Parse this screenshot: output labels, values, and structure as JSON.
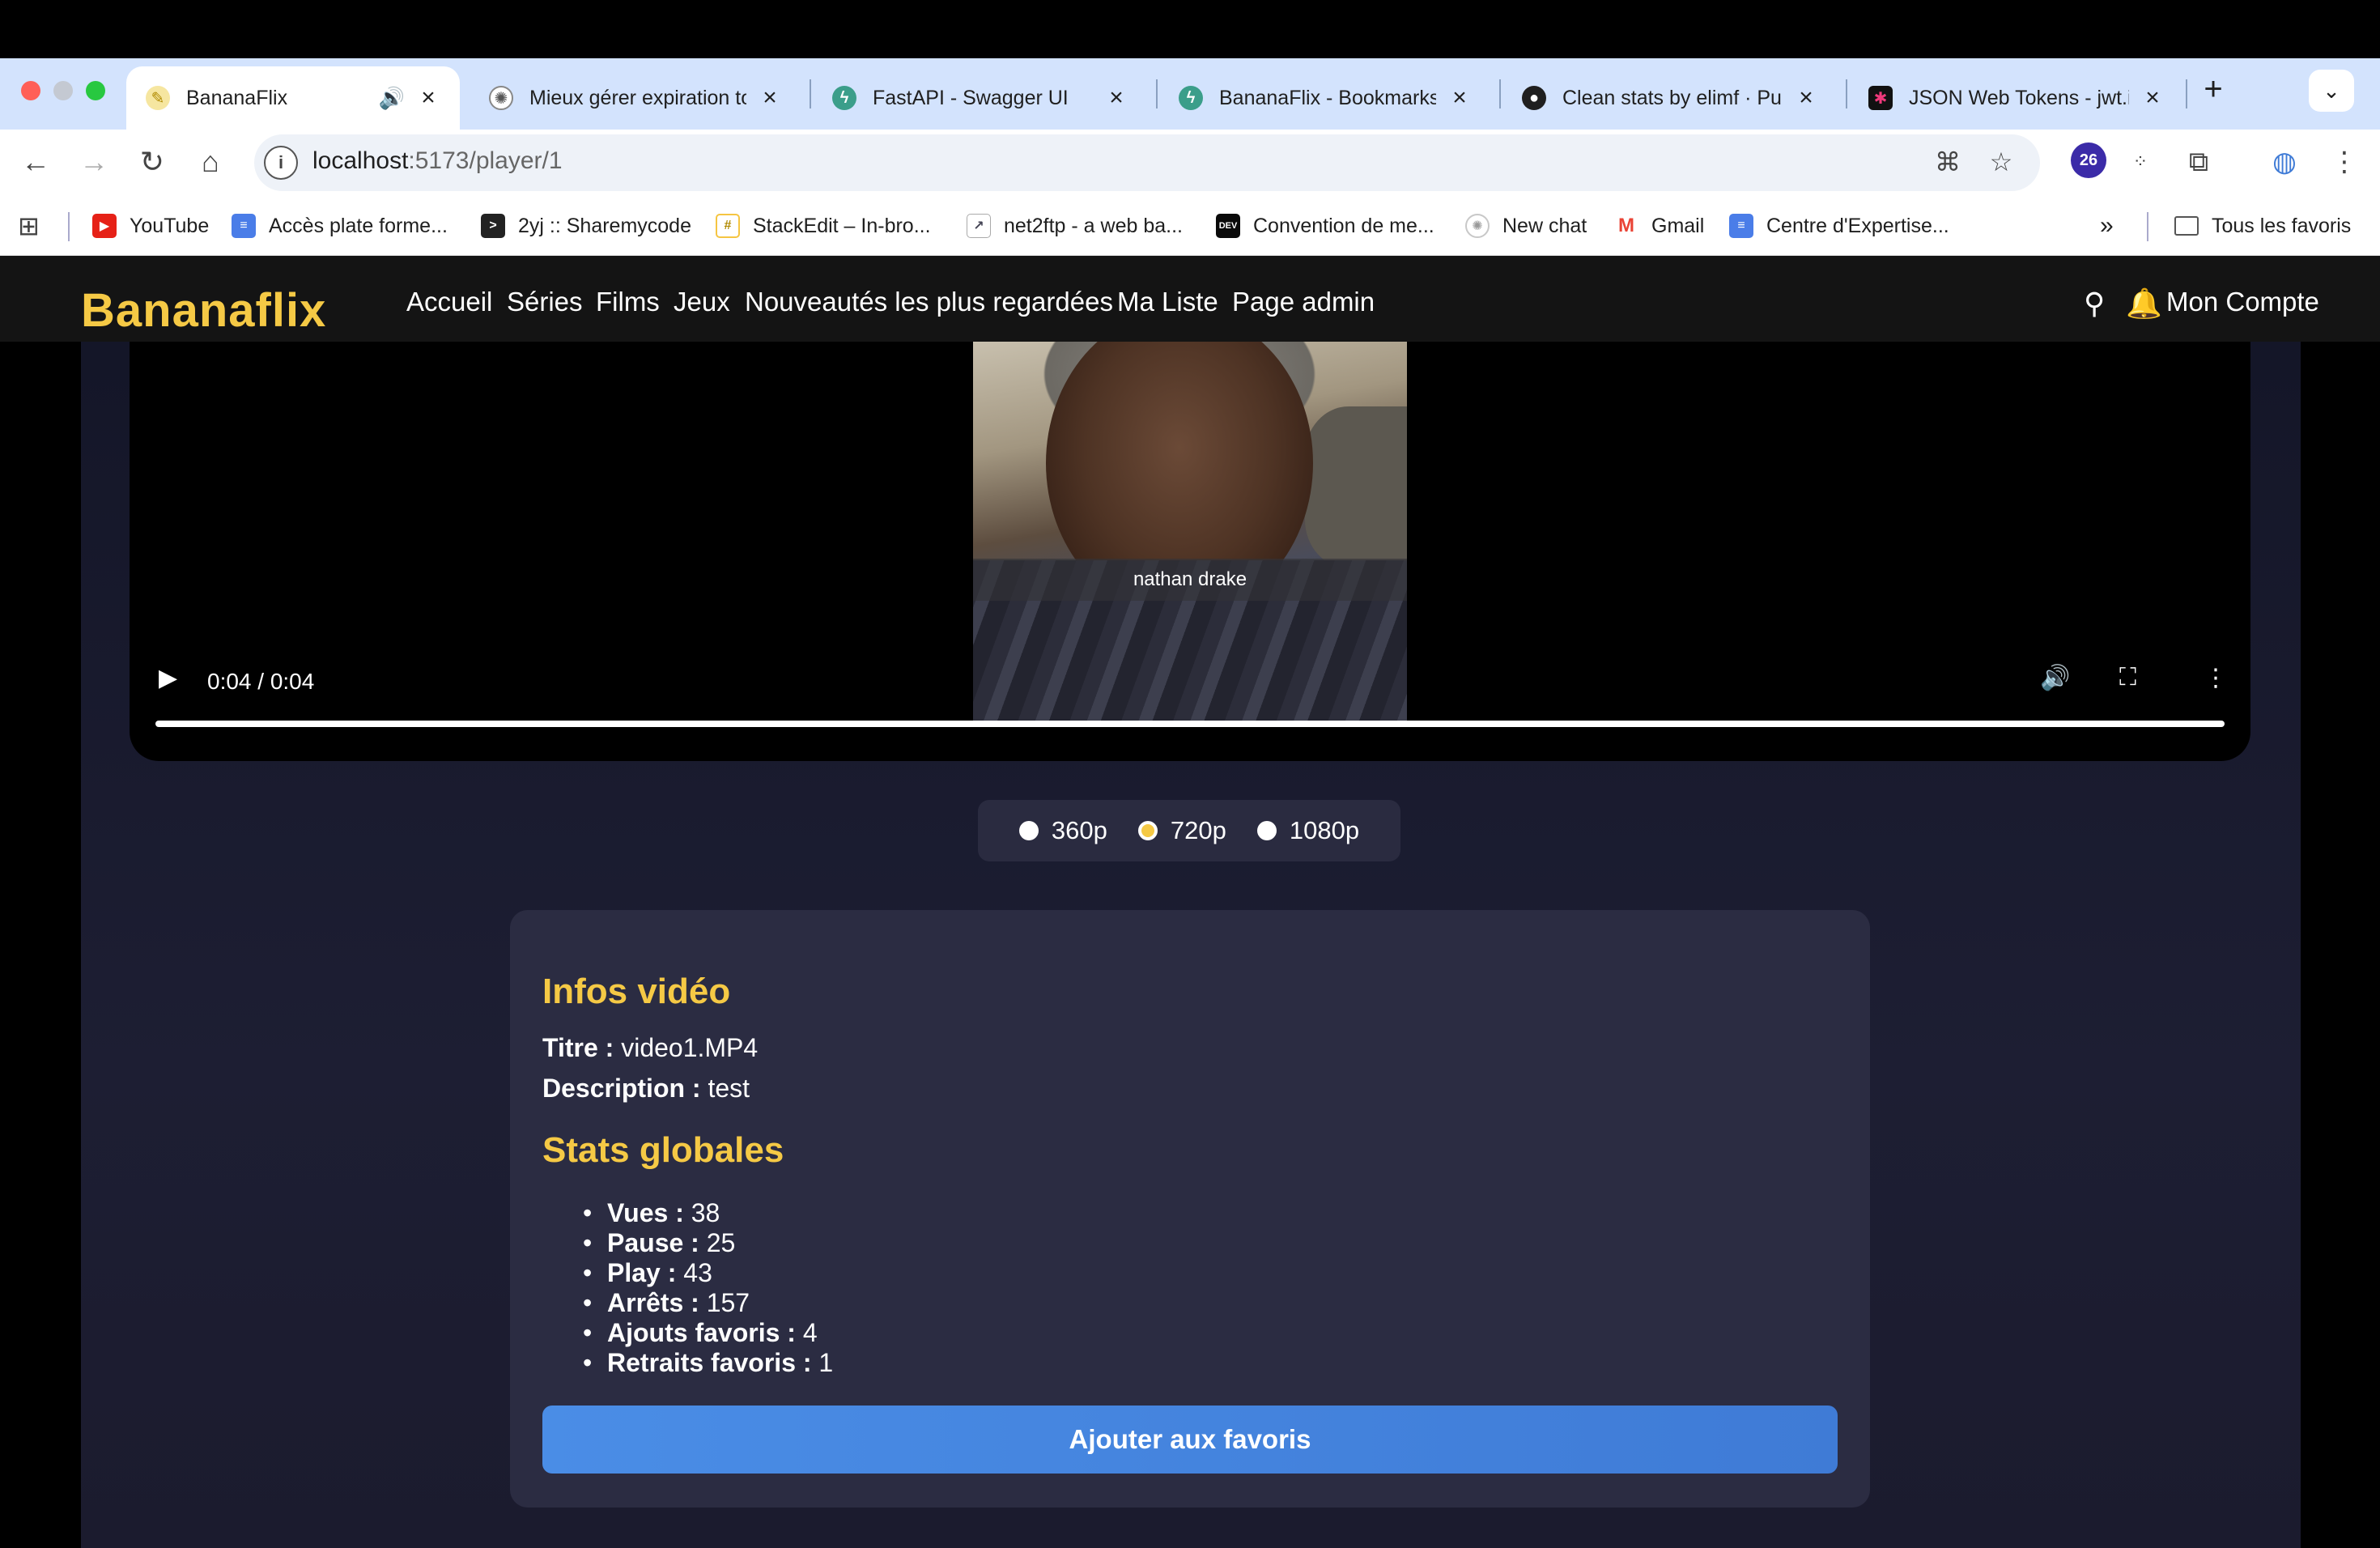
{
  "browser": {
    "tabs": [
      {
        "title": "BananaFlix",
        "icon": "banana-favicon"
      },
      {
        "title": "Mieux gérer expiration to",
        "icon": "chatgpt-favicon"
      },
      {
        "title": "FastAPI - Swagger UI",
        "icon": "fastapi-favicon"
      },
      {
        "title": "BananaFlix - Bookmarks",
        "icon": "fastapi-favicon"
      },
      {
        "title": "Clean stats by elimf · Pul",
        "icon": "github-favicon"
      },
      {
        "title": "JSON Web Tokens - jwt.i",
        "icon": "jwt-favicon"
      }
    ],
    "url_host": "localhost",
    "url_rest": ":5173/player/1",
    "extension_badge": "26",
    "bookmarks": [
      {
        "label": "YouTube",
        "color": "#e62117"
      },
      {
        "label": "Accès plate forme...",
        "color": "#4a7de8"
      },
      {
        "label": "2yj :: Sharemycode",
        "color": "#222222"
      },
      {
        "label": "StackEdit – In-bro...",
        "color": "#f5c542"
      },
      {
        "label": "net2ftp - a web ba...",
        "color": "#7a8aa8"
      },
      {
        "label": "Convention de me...",
        "color": "#0a0a0a"
      },
      {
        "label": "New chat",
        "color": "#c8c8c8"
      },
      {
        "label": "Gmail",
        "color": "#ea4335"
      },
      {
        "label": "Centre d'Expertise...",
        "color": "#4a7de8"
      }
    ],
    "all_bookmarks": "Tous les favoris"
  },
  "site": {
    "logo": "Bananaflix",
    "nav": [
      "Accueil",
      "Séries",
      "Films",
      "Jeux",
      "Nouveautés les plus regardées",
      "Ma Liste",
      "Page admin"
    ],
    "account": "Mon Compte"
  },
  "player": {
    "caption": "nathan drake",
    "time": "0:04 / 0:04",
    "progress": 1.0
  },
  "quality": {
    "options": [
      "360p",
      "720p",
      "1080p"
    ],
    "selected": "720p"
  },
  "info": {
    "title_heading": "Infos vidéo",
    "titre_label": "Titre :",
    "titre_value": "video1.MP4",
    "description_label": "Description :",
    "description_value": "test",
    "stats_heading": "Stats globales",
    "stats": [
      {
        "label": "Vues :",
        "value": "38"
      },
      {
        "label": "Pause :",
        "value": "25"
      },
      {
        "label": "Play :",
        "value": "43"
      },
      {
        "label": "Arrêts :",
        "value": "157"
      },
      {
        "label": "Ajouts favoris :",
        "value": "4"
      },
      {
        "label": "Retraits favoris :",
        "value": "1"
      }
    ],
    "fav_button": "Ajouter aux favoris"
  },
  "colors": {
    "accent": "#f5c945",
    "button": "#4a8de6",
    "card": "#2b2c42"
  }
}
